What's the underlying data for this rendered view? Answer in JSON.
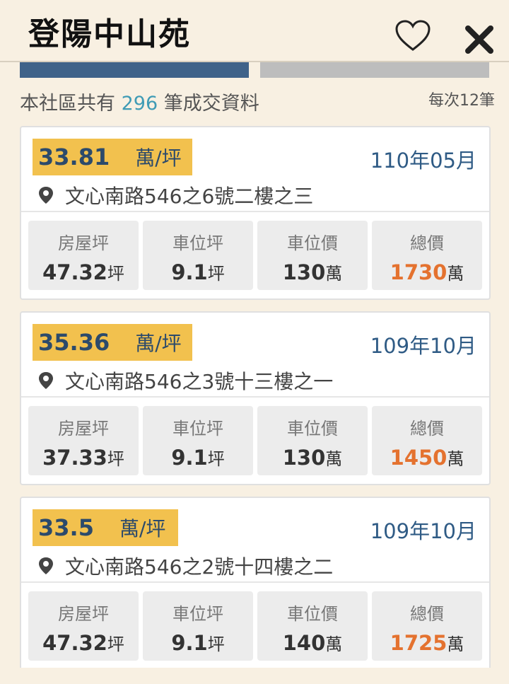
{
  "header": {
    "title": "登陽中山苑"
  },
  "progress": {
    "fraction": 0.5
  },
  "summary": {
    "prefix": "本社區共有",
    "count": "296",
    "suffix": "筆成交資料",
    "per_page": "每次12筆"
  },
  "labels": {
    "house": "房屋坪",
    "parking_area": "車位坪",
    "parking_price": "車位價",
    "total": "總價"
  },
  "units": {
    "ping": "坪",
    "wan": "萬",
    "per_ping": "萬/坪"
  },
  "listings": [
    {
      "price": "33.81",
      "date": "110年05月",
      "address": "文心南路546之6號二樓之三",
      "house": "47.32",
      "parking_area": "9.1",
      "parking_price": "130",
      "total": "1730"
    },
    {
      "price": "35.36",
      "date": "109年10月",
      "address": "文心南路546之3號十三樓之一",
      "house": "37.33",
      "parking_area": "9.1",
      "parking_price": "130",
      "total": "1450"
    },
    {
      "price": "33.5",
      "date": "109年10月",
      "address": "文心南路546之2號十四樓之二",
      "house": "47.32",
      "parking_area": "9.1",
      "parking_price": "140",
      "total": "1725"
    }
  ],
  "colors": {
    "accent": "#3f6289",
    "highlight": "#f2c14e",
    "total": "#e4722f",
    "count": "#3f9bb5"
  },
  "icons": {
    "favorite": "heart-icon",
    "close": "close-icon",
    "location": "map-pin-icon"
  }
}
